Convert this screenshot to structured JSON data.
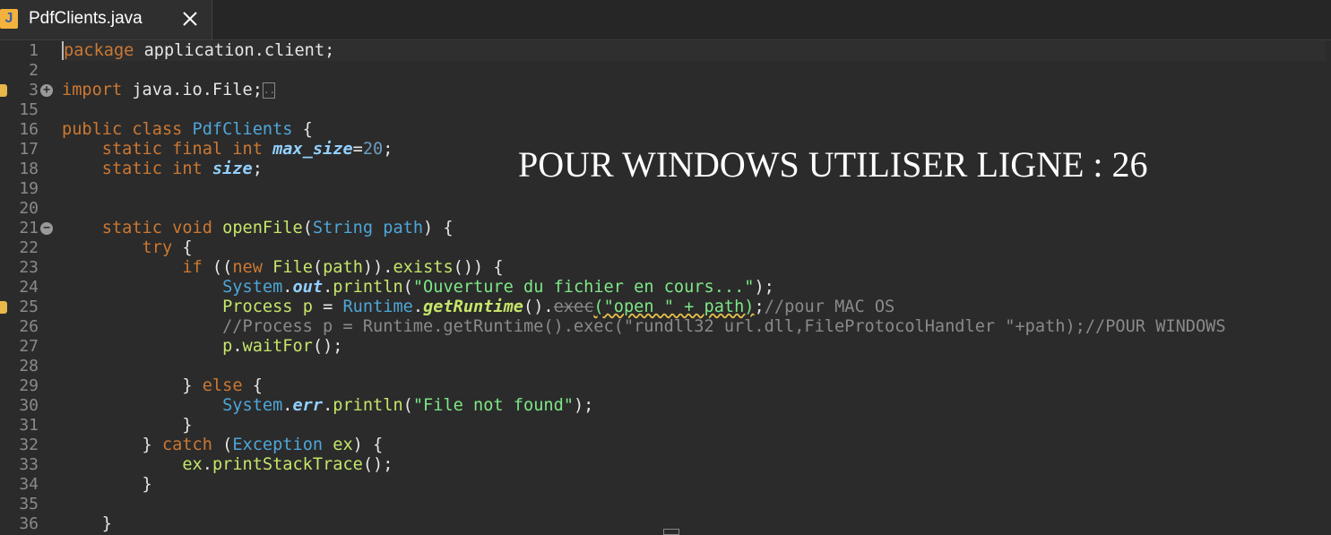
{
  "tab": {
    "title": "PdfClients.java",
    "icon": "java-file-icon",
    "close_glyph": "✕"
  },
  "overlay_text": "POUR WINDOWS UTILISER LIGNE : 26",
  "colors": {
    "background": "#2b2b2b",
    "keyword": "#cc7832",
    "class": "#4ea6d8",
    "string": "#7ee787",
    "method": "#c5e66a",
    "comment": "#8a8a8a"
  },
  "lines": [
    {
      "n": "1",
      "segs": [
        [
          "package",
          "kw"
        ],
        [
          " application.client;",
          ""
        ]
      ]
    },
    {
      "n": "2",
      "segs": []
    },
    {
      "n": "3",
      "segs": [
        [
          "import",
          "kw"
        ],
        [
          " java.io.File;",
          ""
        ]
      ]
    },
    {
      "n": "15",
      "segs": []
    },
    {
      "n": "16",
      "segs": [
        [
          "public class ",
          "kw"
        ],
        [
          "PdfClients",
          "cls"
        ],
        [
          " {",
          ""
        ]
      ]
    },
    {
      "n": "17",
      "segs": [
        [
          "    static final int ",
          "kw"
        ],
        [
          "max_size",
          "field"
        ],
        [
          "=",
          ""
        ],
        [
          "20",
          "num"
        ],
        [
          ";",
          ""
        ]
      ]
    },
    {
      "n": "18",
      "segs": [
        [
          "    static int ",
          "kw"
        ],
        [
          "size",
          "field"
        ],
        [
          ";",
          ""
        ]
      ]
    },
    {
      "n": "19",
      "segs": []
    },
    {
      "n": "20",
      "segs": []
    },
    {
      "n": "21",
      "segs": [
        [
          "    static void ",
          "kw"
        ],
        [
          "openFile",
          "fn"
        ],
        [
          "(",
          ""
        ],
        [
          "String",
          "cls"
        ],
        [
          " ",
          ""
        ],
        [
          "path",
          "cls"
        ],
        [
          ") {",
          ""
        ]
      ]
    },
    {
      "n": "22",
      "segs": [
        [
          "        try",
          "kw"
        ],
        [
          " {",
          ""
        ]
      ]
    },
    {
      "n": "23",
      "segs": [
        [
          "            if",
          "kw"
        ],
        [
          " ((",
          ""
        ],
        [
          "new",
          "kw"
        ],
        [
          " ",
          ""
        ],
        [
          "File",
          "fn"
        ],
        [
          "(",
          ""
        ],
        [
          "path",
          "fn"
        ],
        [
          ")).",
          ""
        ],
        [
          "exists",
          "fn"
        ],
        [
          "()) {",
          ""
        ]
      ]
    },
    {
      "n": "24",
      "segs": [
        [
          "                System",
          "cls"
        ],
        [
          ".",
          ""
        ],
        [
          "out",
          "field"
        ],
        [
          ".",
          ""
        ],
        [
          "println",
          "fn"
        ],
        [
          "(",
          ""
        ],
        [
          "\"Ouverture du fichier en cours...\"",
          "str"
        ],
        [
          ");",
          ""
        ]
      ]
    },
    {
      "n": "25",
      "segs": [
        [
          "                Process",
          "fn"
        ],
        [
          " ",
          ""
        ],
        [
          "p",
          "fn"
        ],
        [
          " = ",
          ""
        ],
        [
          "Runtime",
          "cls"
        ],
        [
          ".",
          ""
        ],
        [
          "getRuntime",
          "static-call"
        ],
        [
          "().",
          ""
        ],
        [
          "exec",
          "cmt dep"
        ],
        [
          "(\"open \" + path)",
          "str warn"
        ],
        [
          ";",
          ""
        ],
        [
          "//pour MAC OS",
          "cmt"
        ]
      ]
    },
    {
      "n": "26",
      "segs": [
        [
          "                //Process p = Runtime.getRuntime().exec(\"rundll32 url.dll,FileProtocolHandler \"+path);//POUR WINDOWS",
          "cmt"
        ]
      ]
    },
    {
      "n": "27",
      "segs": [
        [
          "                p",
          "fn"
        ],
        [
          ".",
          ""
        ],
        [
          "waitFor",
          "fn"
        ],
        [
          "();",
          ""
        ]
      ]
    },
    {
      "n": "28",
      "segs": []
    },
    {
      "n": "29",
      "segs": [
        [
          "            } ",
          ""
        ],
        [
          "else",
          "kw"
        ],
        [
          " {",
          ""
        ]
      ]
    },
    {
      "n": "30",
      "segs": [
        [
          "                System",
          "cls"
        ],
        [
          ".",
          ""
        ],
        [
          "err",
          "field"
        ],
        [
          ".",
          ""
        ],
        [
          "println",
          "fn"
        ],
        [
          "(",
          ""
        ],
        [
          "\"File not found\"",
          "str"
        ],
        [
          ");",
          ""
        ]
      ]
    },
    {
      "n": "31",
      "segs": [
        [
          "            }",
          ""
        ]
      ]
    },
    {
      "n": "32",
      "segs": [
        [
          "        } ",
          ""
        ],
        [
          "catch",
          "kw"
        ],
        [
          " (",
          ""
        ],
        [
          "Exception",
          "cls"
        ],
        [
          " ",
          ""
        ],
        [
          "ex",
          "fn"
        ],
        [
          ") {",
          ""
        ]
      ]
    },
    {
      "n": "33",
      "segs": [
        [
          "            ex",
          "fn"
        ],
        [
          ".",
          ""
        ],
        [
          "printStackTrace",
          "fn"
        ],
        [
          "();",
          ""
        ]
      ]
    },
    {
      "n": "34",
      "segs": [
        [
          "        }",
          ""
        ]
      ]
    },
    {
      "n": "35",
      "segs": []
    },
    {
      "n": "36",
      "segs": [
        [
          "    }",
          ""
        ]
      ]
    }
  ]
}
